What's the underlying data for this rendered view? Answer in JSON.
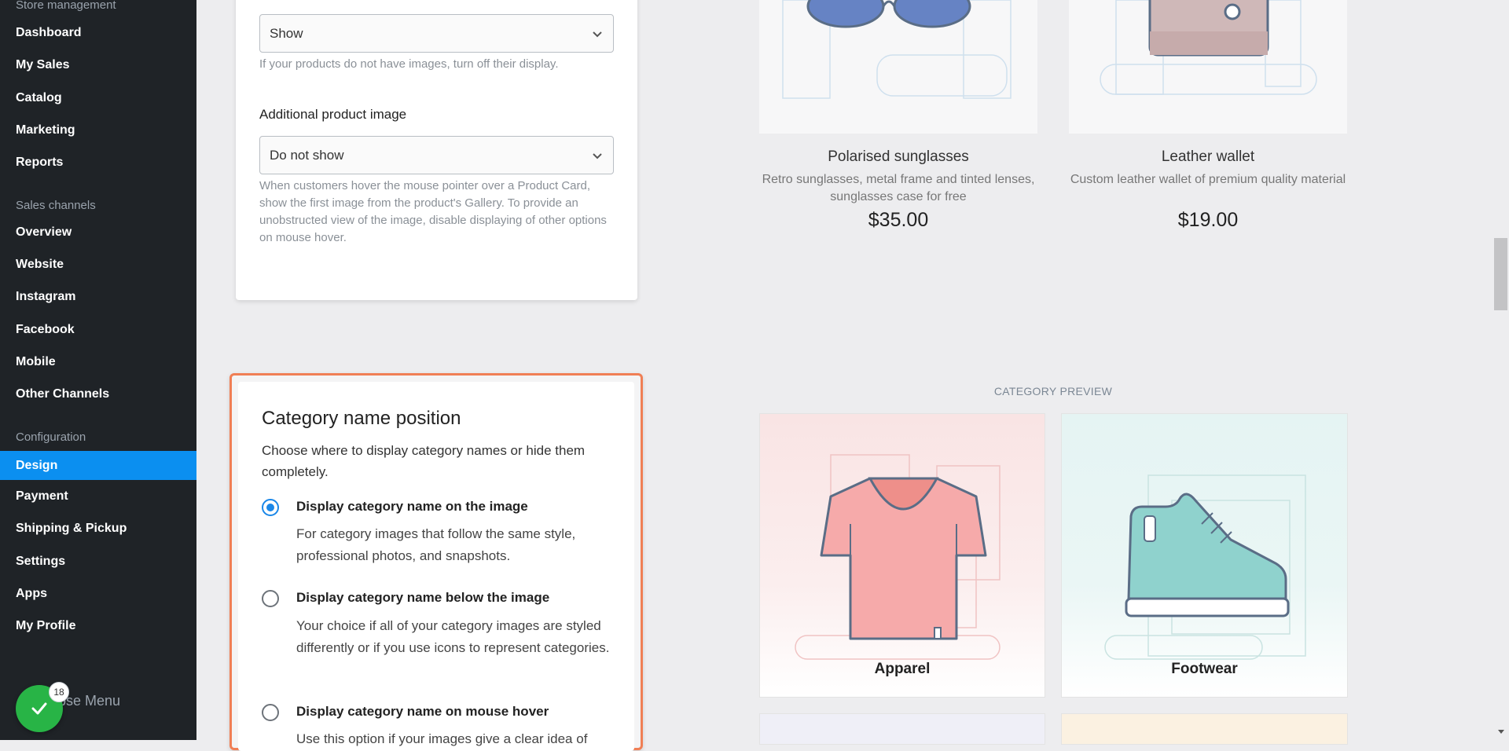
{
  "sidebar": {
    "store_management": "Store management",
    "sales_channels": "Sales channels",
    "configuration": "Configuration",
    "items": [
      {
        "label": "Dashboard"
      },
      {
        "label": "My Sales"
      },
      {
        "label": "Catalog"
      },
      {
        "label": "Marketing"
      },
      {
        "label": "Reports"
      },
      {
        "label": "Overview"
      },
      {
        "label": "Website"
      },
      {
        "label": "Instagram"
      },
      {
        "label": "Facebook"
      },
      {
        "label": "Mobile"
      },
      {
        "label": "Other Channels"
      },
      {
        "label": "Design"
      },
      {
        "label": "Payment"
      },
      {
        "label": "Shipping & Pickup"
      },
      {
        "label": "Settings"
      },
      {
        "label": "Apps"
      },
      {
        "label": "My Profile"
      }
    ],
    "active_item": "Design",
    "collapse_label": "lapse Menu",
    "badge_count": "18",
    "accent_color": "#0b8ff0"
  },
  "image_settings": {
    "product_image_select": "Show",
    "product_image_hint": "If your products do not have images, turn off their display.",
    "additional_label": "Additional product image",
    "additional_select": "Do not show",
    "additional_hint_lines": [
      "When customers hover the mouse pointer over a Product Card,",
      "show the first image from the product's Gallery. To provide an",
      "unobstructed view of the image, disable displaying of other options",
      "on mouse hover."
    ]
  },
  "category_position": {
    "title": "Category name position",
    "description": "Choose where to display category names or hide them completely.",
    "options": [
      {
        "title": "Display category name on the image",
        "description": "For category images that follow the same style, professional photos, and snapshots.",
        "selected": true
      },
      {
        "title": "Display category name below the image",
        "description": "Your choice if all of your category images are styled differently or if you use icons to represent categories.",
        "selected": false
      },
      {
        "title": "Display category name on mouse hover",
        "description": "Use this option if your images give a clear idea of",
        "selected": false
      }
    ],
    "highlight_color": "#f07f55"
  },
  "product_preview": [
    {
      "name": "Polarised sunglasses",
      "description": "Retro sunglasses, metal frame and tinted lenses, sunglasses case for free",
      "price": "$35.00",
      "icon": "sunglasses-illustration"
    },
    {
      "name": "Leather wallet",
      "description": "Custom leather wallet of premium quality material",
      "price": "$19.00",
      "icon": "wallet-illustration"
    }
  ],
  "category_preview": {
    "title": "CATEGORY PREVIEW",
    "categories": [
      {
        "name": "Apparel",
        "icon": "tshirt-illustration"
      },
      {
        "name": "Footwear",
        "icon": "sneaker-illustration"
      }
    ]
  }
}
